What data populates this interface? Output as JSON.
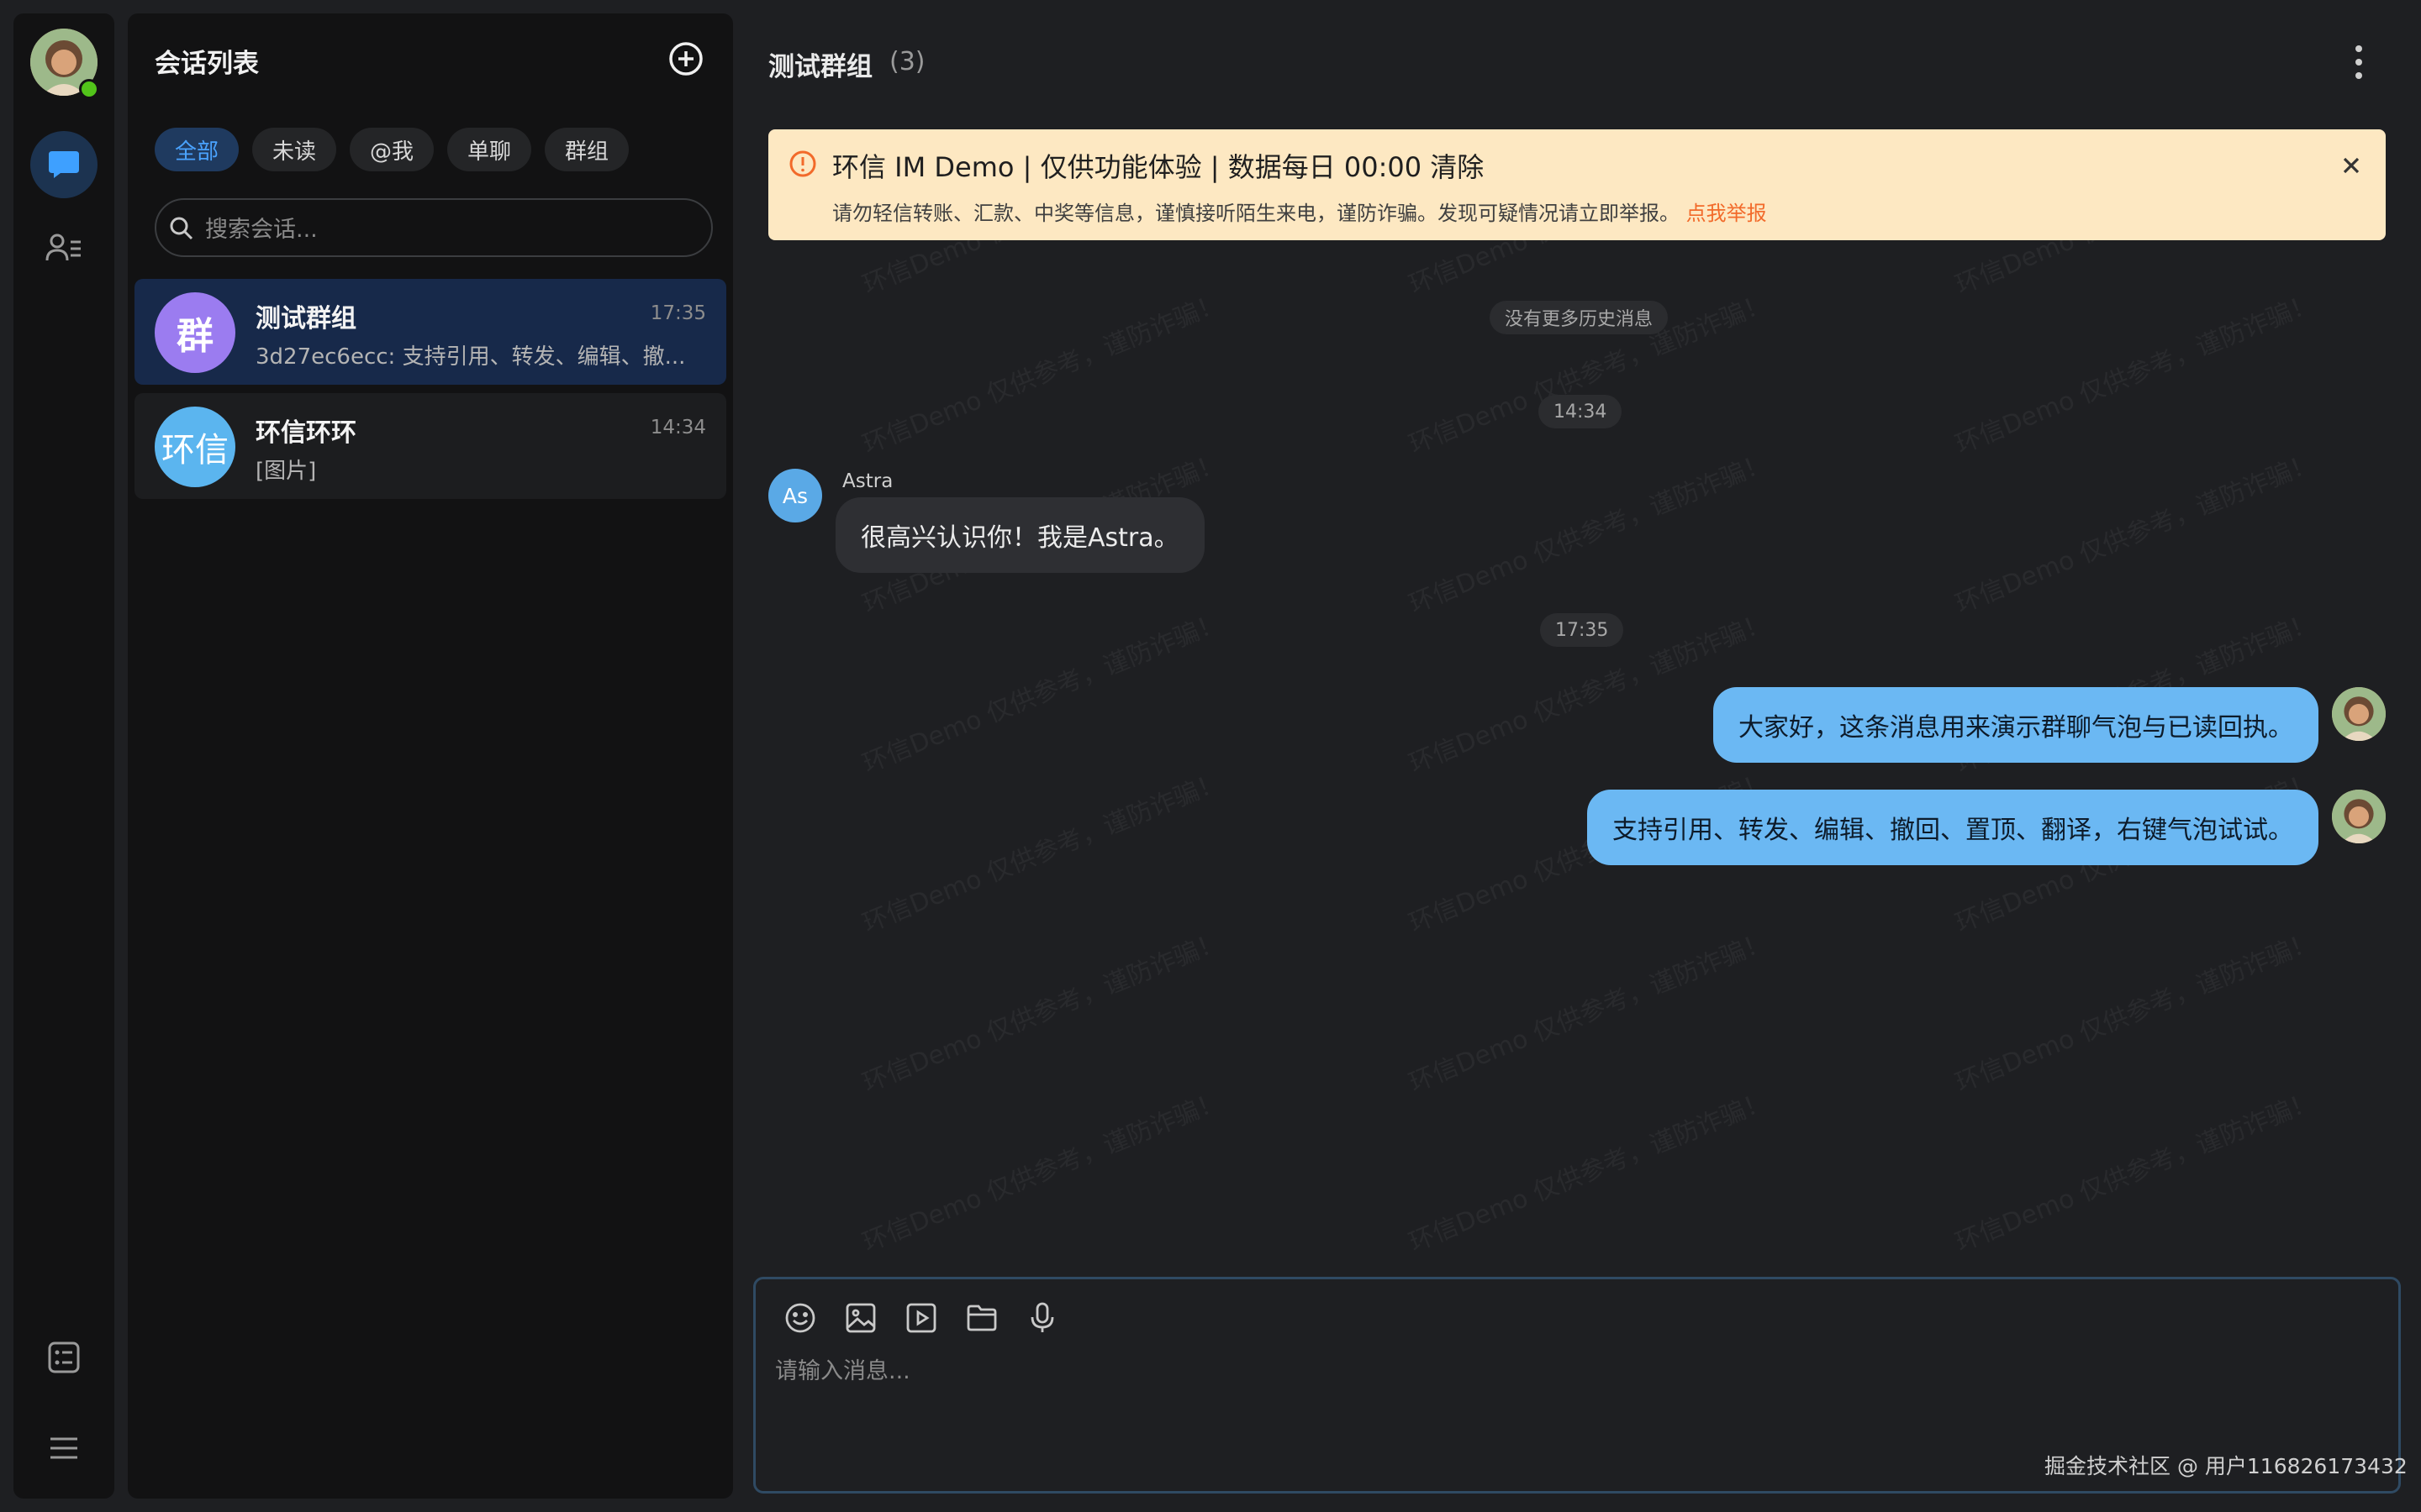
{
  "sidebar": {
    "nav": [
      "chat-icon",
      "contacts-icon",
      "tasks-icon",
      "menu-icon"
    ]
  },
  "conversations": {
    "title": "会话列表",
    "filters": [
      "全部",
      "未读",
      "@我",
      "单聊",
      "群组"
    ],
    "active_filter": "全部",
    "search_placeholder": "搜索会话...",
    "items": [
      {
        "avatar_text": "群",
        "name": "测试群组",
        "time": "17:35",
        "preview": "3d27ec6ecc: 支持引用、转发、编辑、撤...",
        "avatar_color": "#9b7cf0"
      },
      {
        "avatar_text": "环信",
        "name": "环信环环",
        "time": "14:34",
        "preview": "[图片]",
        "avatar_color": "#5bb5ef"
      }
    ]
  },
  "chat": {
    "title": "测试群组",
    "member_count": "(3)",
    "notice": {
      "title": "环信 IM Demo | 仅供功能体验 | 数据每日 00:00 清除",
      "text": "请勿轻信转账、汇款、中奖等信息，谨慎接听陌生来电，谨防诈骗。发现可疑情况请立即举报。",
      "link": "点我举报"
    },
    "watermark": "环信Demo 仅供参考，谨防诈骗！",
    "no_more_history": "没有更多历史消息",
    "time_1": "14:34",
    "time_2": "17:35",
    "peer": {
      "avatar_text": "As",
      "name": "Astra",
      "message": "很高兴认识你！我是Astra。"
    },
    "my_messages": [
      "大家好，这条消息用来演示群聊气泡与已读回执。",
      "支持引用、转发、编辑、撤回、置顶、翻译，右键气泡试试。"
    ]
  },
  "composer": {
    "placeholder": "请输入消息...",
    "tools": [
      "emoji-icon",
      "image-icon",
      "video-icon",
      "folder-icon",
      "microphone-icon"
    ]
  },
  "footer": {
    "credit": "掘金技术社区 @ 用户116826173432"
  },
  "colors": {
    "accent": "#4aa3ff",
    "bubble_mine": "#6bb8f3",
    "notice_bg": "#fde8c2",
    "link": "#f26a2a"
  }
}
